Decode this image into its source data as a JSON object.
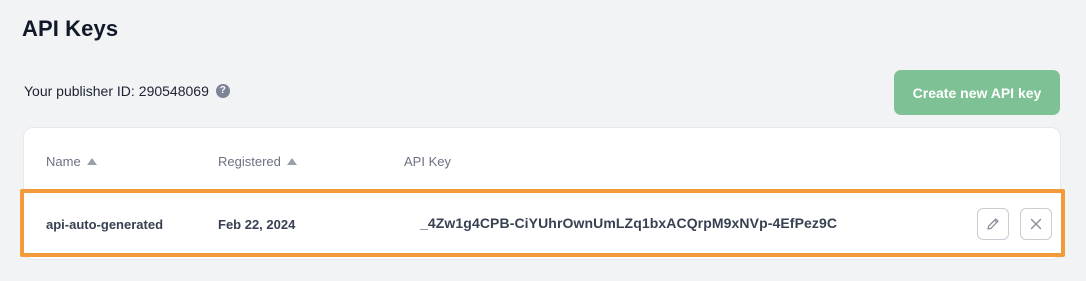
{
  "page": {
    "title": "API Keys"
  },
  "publisher": {
    "label": "Your publisher ID:",
    "value": "290548069",
    "help_icon": "?"
  },
  "actions": {
    "create_label": "Create new API key",
    "create_color": "#7ec194"
  },
  "table": {
    "columns": [
      {
        "label": "Name",
        "sortable": true
      },
      {
        "label": "Registered",
        "sortable": true
      },
      {
        "label": "API Key",
        "sortable": false
      }
    ],
    "rows": [
      {
        "name": "api-auto-generated",
        "registered": "Feb 22, 2024",
        "api_key": "_4Zw1g4CPB-CiYUhrOwnUmLZq1bxACQrpM9xNVp-4EfPez9C",
        "highlighted": true
      }
    ]
  },
  "icons": {
    "help": "question-circle-icon",
    "sort": "sort-ascending-icon",
    "edit": "pencil-icon",
    "delete": "close-icon"
  },
  "colors": {
    "highlight_border": "#f39a3b",
    "background": "#f2f3f5"
  }
}
